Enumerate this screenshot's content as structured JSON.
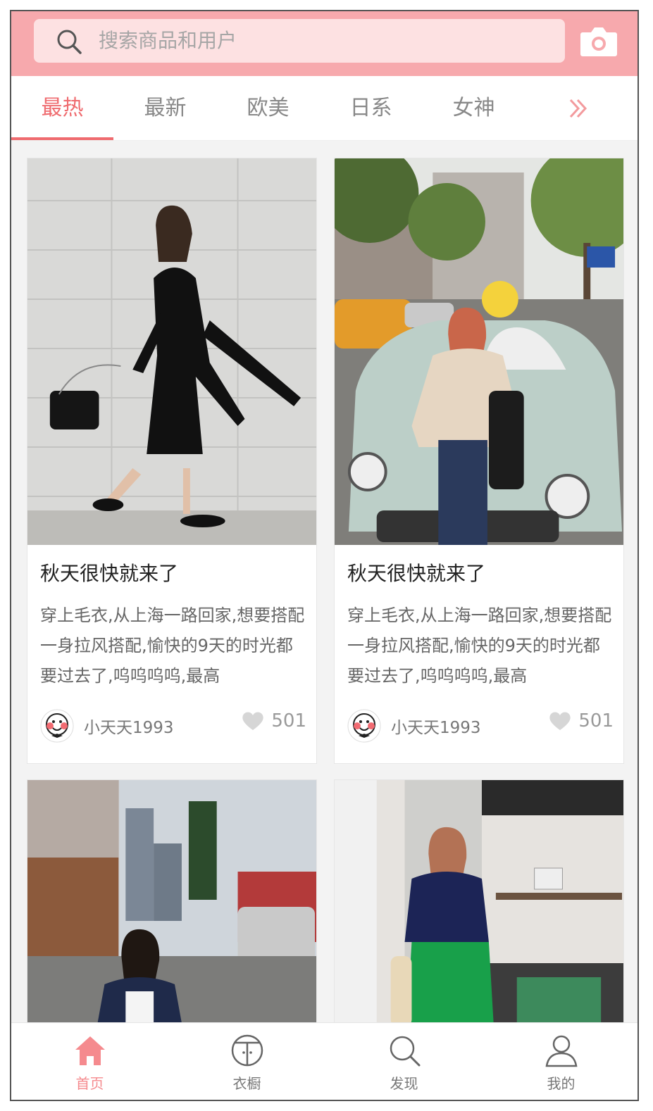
{
  "colors": {
    "accent": "#ef6b6f",
    "header_bg": "#f7a9ad",
    "search_bg": "#fde1e2",
    "nav_active": "#f58a8e"
  },
  "search": {
    "placeholder": "搜索商品和用户",
    "icon": "search-icon"
  },
  "header": {
    "camera_icon": "camera-icon"
  },
  "tabs": [
    {
      "label": "最热",
      "active": true
    },
    {
      "label": "最新",
      "active": false
    },
    {
      "label": "欧美",
      "active": false
    },
    {
      "label": "日系",
      "active": false
    },
    {
      "label": "女神",
      "active": false
    }
  ],
  "tabs_more_icon": "double-chevron-right-icon",
  "feed": {
    "cards": [
      {
        "title": "秋天很快就来了",
        "description": "穿上毛衣,从上海一路回家,想要搭配一身拉风搭配,愉快的9天的时光都要过去了,呜呜呜呜,最高",
        "author": "小天天1993",
        "likes": "501"
      },
      {
        "title": "秋天很快就来了",
        "description": "穿上毛衣,从上海一路回家,想要搭配一身拉风搭配,愉快的9天的时光都要过去了,呜呜呜呜,最高",
        "author": "小天天1993",
        "likes": "501"
      },
      {},
      {}
    ]
  },
  "bottom_nav": [
    {
      "label": "首页",
      "icon": "home-icon",
      "active": true
    },
    {
      "label": "衣橱",
      "icon": "wardrobe-icon",
      "active": false
    },
    {
      "label": "发现",
      "icon": "discover-search-icon",
      "active": false
    },
    {
      "label": "我的",
      "icon": "profile-icon",
      "active": false
    }
  ]
}
